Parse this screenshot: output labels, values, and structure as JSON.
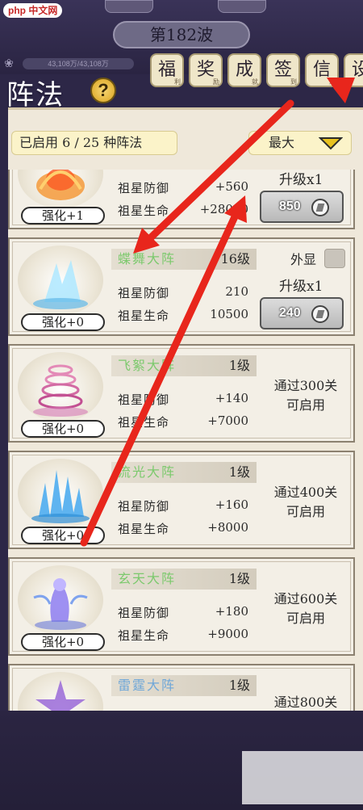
{
  "header": {
    "site_logo": "php 中文网",
    "wave": "第182波",
    "power": "43,108万/43,108万",
    "power_icon": "lotus-icon"
  },
  "menu_tabs": [
    {
      "label": "福",
      "sub": "利"
    },
    {
      "label": "奖",
      "sub": "励"
    },
    {
      "label": "成",
      "sub": "就"
    },
    {
      "label": "签",
      "sub": "到"
    },
    {
      "label": "信",
      "sub": "息"
    },
    {
      "label": "设",
      "sub": ""
    }
  ],
  "title": "阵法",
  "help_icon": "?",
  "summary": "已启用 6 / 25 种阵法",
  "sort": {
    "label": "最大",
    "icon": "triangle-down-icon",
    "color": "#e8c21f"
  },
  "formations": [
    {
      "name": "",
      "level": "",
      "enhance": "强化+1",
      "stats": [
        {
          "label": "祖星防御",
          "value": "+560"
        },
        {
          "label": "祖星生命",
          "value": "+28000"
        }
      ],
      "show_label": "",
      "upgrade_label": "升级x1",
      "cost": "850",
      "unlock": "",
      "art": "fire-lotus"
    },
    {
      "name": "蝶舞大阵",
      "level": "16级",
      "enhance": "强化+0",
      "stats": [
        {
          "label": "祖星防御",
          "value": "210"
        },
        {
          "label": "祖星生命",
          "value": "10500"
        }
      ],
      "show_label": "外显",
      "upgrade_label": "升级x1",
      "cost": "240",
      "unlock": "",
      "art": "ice-butterfly"
    },
    {
      "name": "飞絮大阵",
      "level": "1级",
      "enhance": "强化+0",
      "stats": [
        {
          "label": "祖星防御",
          "value": "+140"
        },
        {
          "label": "祖星生命",
          "value": "+7000"
        }
      ],
      "unlock": "通过300关\n可启用",
      "art": "pink-whirl"
    },
    {
      "name": "流光大阵",
      "level": "1级",
      "enhance": "强化+0",
      "stats": [
        {
          "label": "祖星防御",
          "value": "+160"
        },
        {
          "label": "祖星生命",
          "value": "+8000"
        }
      ],
      "unlock": "通过400关\n可启用",
      "art": "blue-spikes"
    },
    {
      "name": "玄天大阵",
      "level": "1级",
      "enhance": "强化+0",
      "stats": [
        {
          "label": "祖星防御",
          "value": "+180"
        },
        {
          "label": "祖星生命",
          "value": "+9000"
        }
      ],
      "unlock": "通过600关\n可启用",
      "art": "violet-spirit"
    },
    {
      "name": "雷霆大阵",
      "level": "1级",
      "enhance": "",
      "stats": [],
      "unlock": "通过800关",
      "art": "purple-star"
    }
  ],
  "colors": {
    "name_green": "#7cc96d",
    "name_blue": "#6fa7d8",
    "annotation_red": "#e8261c"
  }
}
